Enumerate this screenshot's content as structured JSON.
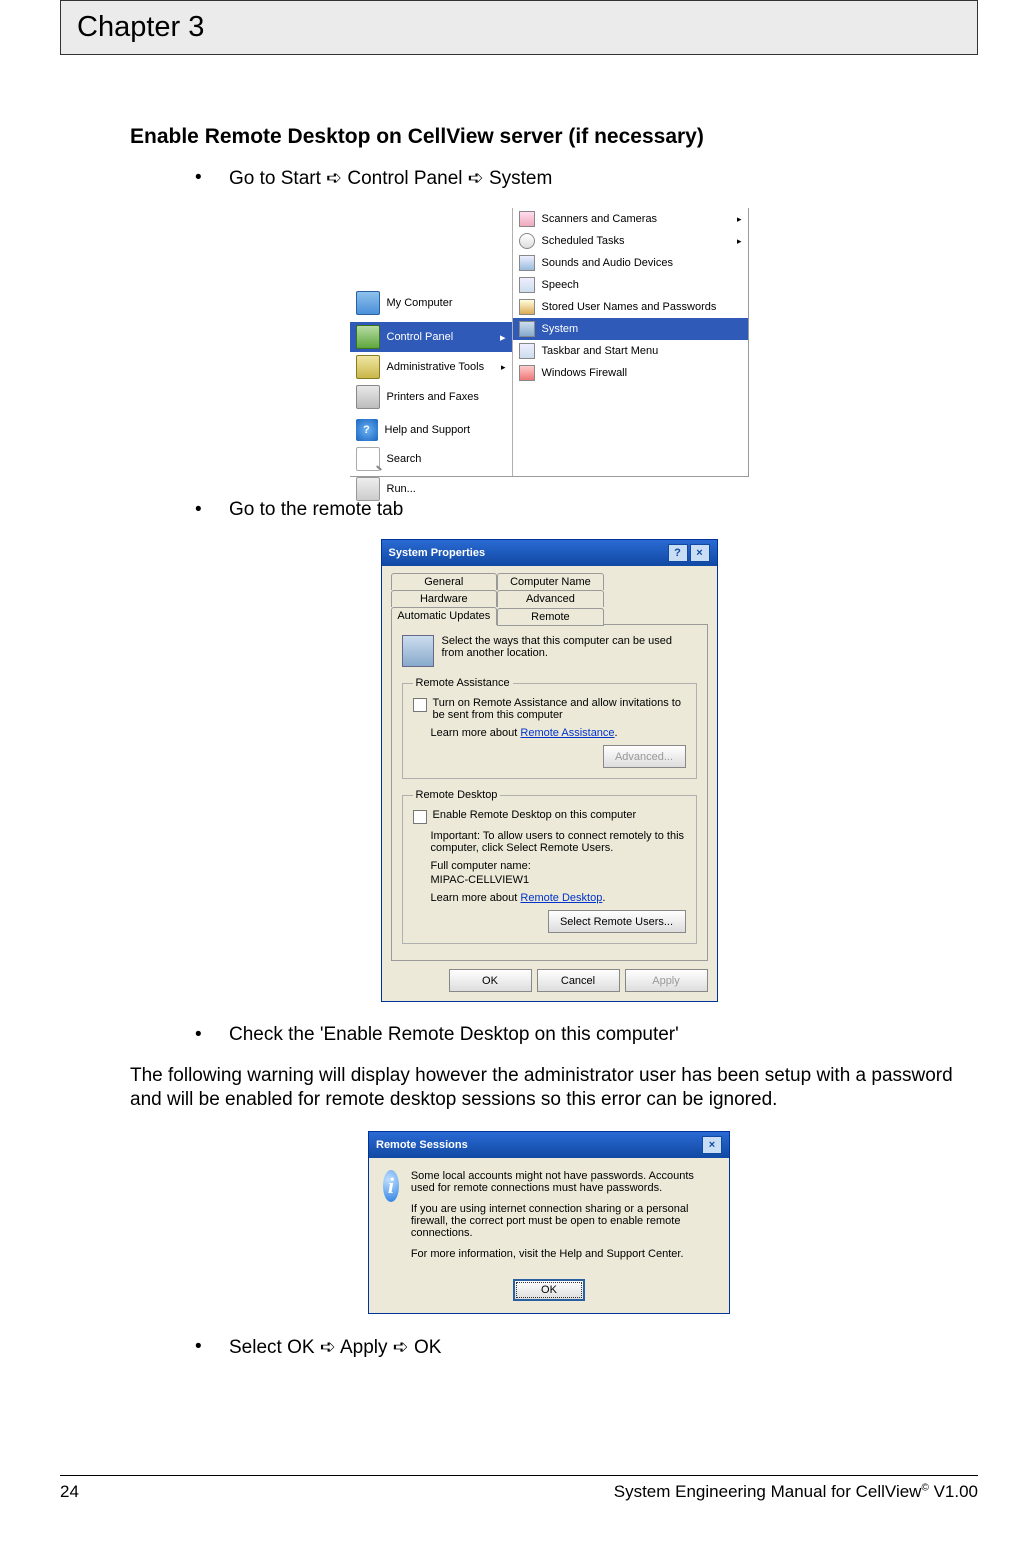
{
  "chapter_header": "Chapter 3",
  "section_heading": "Enable Remote Desktop on CellView server (if necessary)",
  "bullets": {
    "b1_pre": "Go to Start ",
    "b1_mid": " Control Panel ",
    "b1_post": " System",
    "b2": "Go to the remote tab",
    "b3": "Check the 'Enable Remote Desktop on this computer'",
    "b4_pre": "Select OK ",
    "b4_mid": " Apply ",
    "b4_post": " OK"
  },
  "arrow_glyph": "➪",
  "paragraph": "The following warning will display however the administrator user has been setup with a password and will be enabled for remote desktop sessions so this error can be ignored.",
  "shot1": {
    "left": {
      "my_computer": "My Computer",
      "control_panel": "Control Panel",
      "admin_tools": "Administrative Tools",
      "printers": "Printers and Faxes",
      "help": "Help and Support",
      "search": "Search",
      "run": "Run..."
    },
    "right": {
      "scanners": "Scanners and Cameras",
      "tasks": "Scheduled Tasks",
      "sounds": "Sounds and Audio Devices",
      "speech": "Speech",
      "stored": "Stored User Names and Passwords",
      "system": "System",
      "taskbar": "Taskbar and Start Menu",
      "firewall": "Windows Firewall"
    }
  },
  "shot2": {
    "title": "System Properties",
    "tabs": {
      "general": "General",
      "computer_name": "Computer Name",
      "hardware": "Hardware",
      "advanced": "Advanced",
      "automatic_updates": "Automatic Updates",
      "remote": "Remote"
    },
    "intro": "Select the ways that this computer can be used from another location.",
    "ra_legend": "Remote Assistance",
    "ra_check": "Turn on Remote Assistance and allow invitations to be sent from this computer",
    "ra_learn_pre": "Learn more about ",
    "ra_learn_link": "Remote Assistance",
    "advanced_btn": "Advanced...",
    "rd_legend": "Remote Desktop",
    "rd_check": "Enable Remote Desktop on this computer",
    "rd_important": "Important: To allow users to connect remotely to this computer, click Select Remote Users.",
    "rd_full_label": "Full computer name:",
    "rd_full_value": "MIPAC-CELLVIEW1",
    "rd_learn_pre": "Learn more about ",
    "rd_learn_link": "Remote Desktop",
    "select_users_btn": "Select Remote Users...",
    "ok": "OK",
    "cancel": "Cancel",
    "apply": "Apply"
  },
  "shot3": {
    "title": "Remote Sessions",
    "p1": "Some local accounts might not have passwords. Accounts used for remote connections must have passwords.",
    "p2": "If you are using internet connection sharing or a personal firewall, the correct port must be open to enable remote connections.",
    "p3": "For more information, visit the Help and Support Center.",
    "ok": "OK"
  },
  "footer": {
    "page_no": "24",
    "right_pre": "System Engineering Manual for CellView",
    "right_post": " V1.00"
  }
}
